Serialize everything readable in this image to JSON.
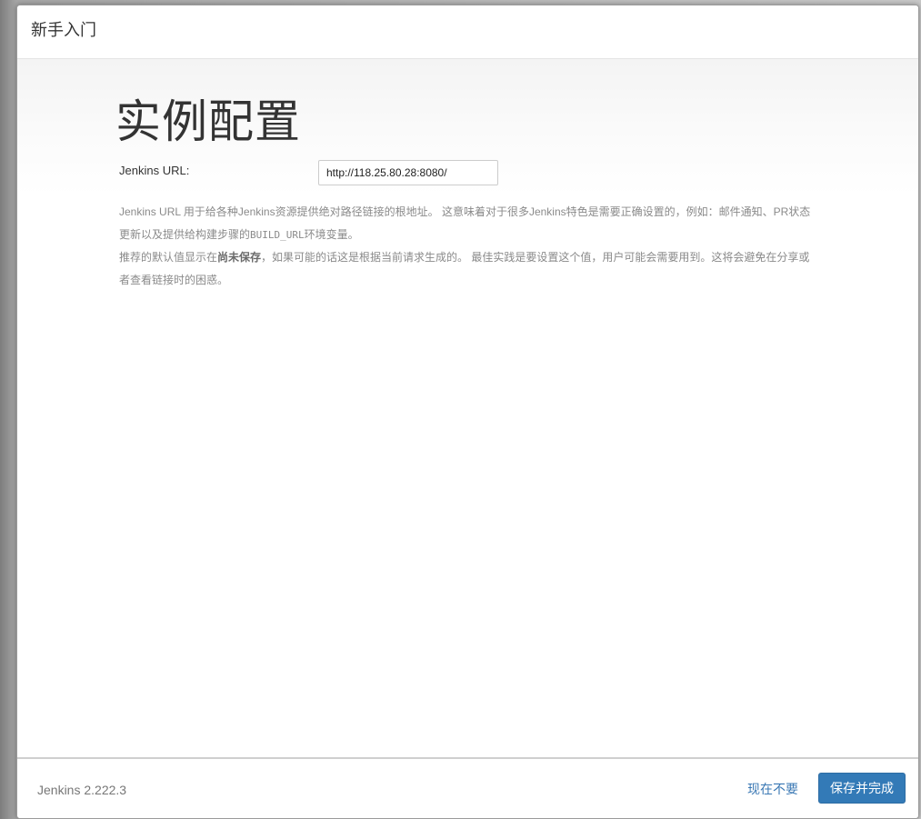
{
  "dialog": {
    "title": "新手入门"
  },
  "main": {
    "heading": "实例配置",
    "url_label": "Jenkins URL:",
    "url_value": "http://118.25.80.28:8080/",
    "help": {
      "p1_part1": "Jenkins URL 用于给各种Jenkins资源提供绝对路径链接的根地址。 这意味着对于很多Jenkins特色是需要正确设置的，例如：邮件通知、PR状态更新以及提供给构建步骤的",
      "p1_code": "BUILD_URL",
      "p1_part2": "环境变量。",
      "p2_part1": "推荐的默认值显示在",
      "p2_bold": "尚未保存",
      "p2_part2": "，如果可能的话这是根据当前请求生成的。 最佳实践是要设置这个值，用户可能会需要用到。这将会避免在分享或者查看链接时的困惑。"
    }
  },
  "footer": {
    "version": "Jenkins 2.222.3",
    "skip_label": "现在不要",
    "save_label": "保存并完成"
  },
  "colors": {
    "primary_button": "#337ab7",
    "link": "#3a78b4"
  }
}
